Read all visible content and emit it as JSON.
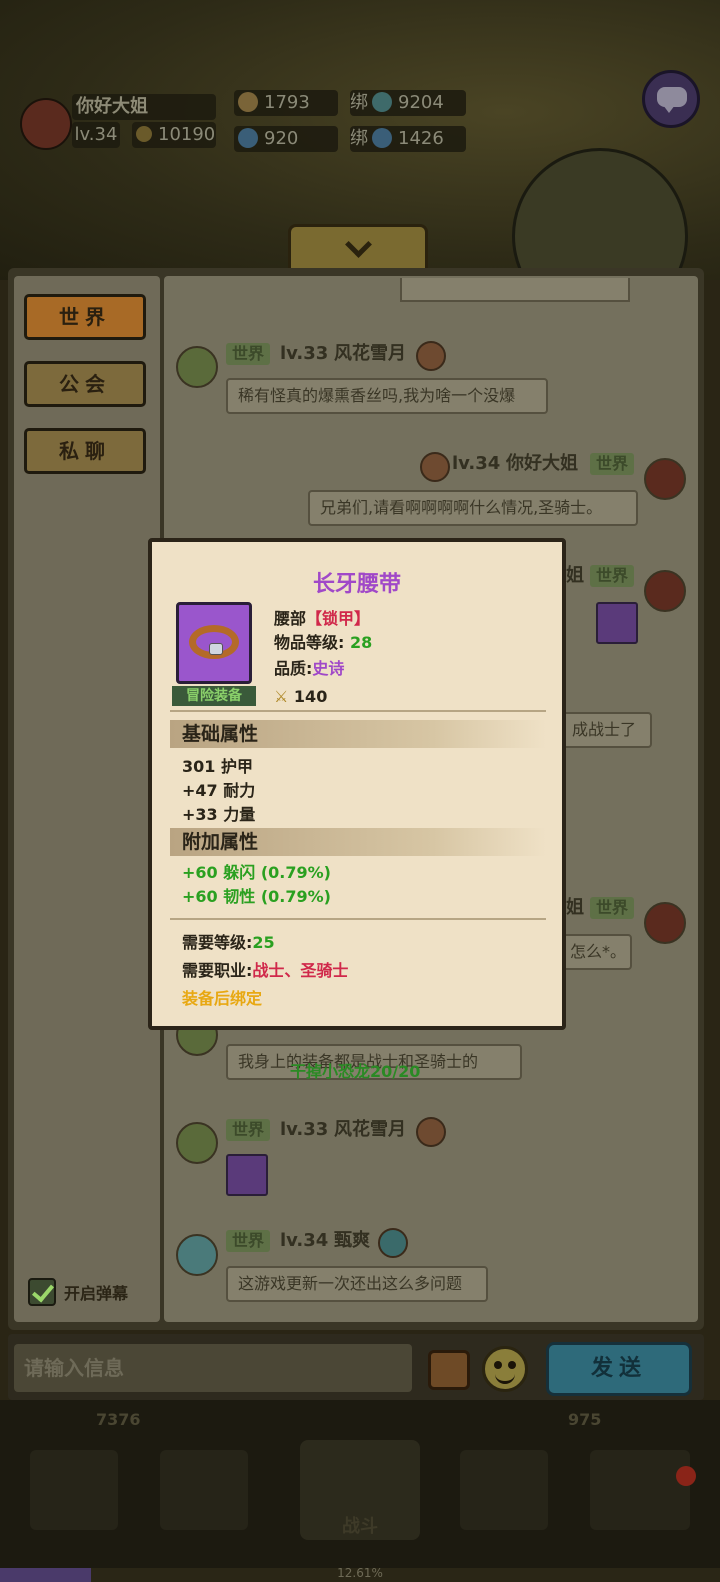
{
  "player": {
    "name": "你好大姐",
    "level": "lv.34",
    "power": "10190"
  },
  "currency": {
    "gold": "1793",
    "bound_gold_label": "绑",
    "bound_gold": "9204",
    "gems": "920",
    "bound_gems_label": "绑",
    "bound_gems": "1426"
  },
  "sidebar": {
    "tabs": [
      {
        "label": "世界"
      },
      {
        "label": "公会"
      },
      {
        "label": "私聊"
      }
    ],
    "barrage_label": "开启弹幕"
  },
  "messages": [
    {
      "channel": "世界",
      "level": "lv.33",
      "user": "风花雪月",
      "text": "稀有怪真的爆熏香丝吗,我为啥一个没爆"
    },
    {
      "channel": "世界",
      "level": "lv.34",
      "user": "你好大姐",
      "text": "兄弟们,请看啊啊啊啊什么情况,圣骑士。"
    },
    {
      "channel": "世界",
      "fragment": "姐",
      "text": "成战士了"
    },
    {
      "channel": "世界",
      "fragment": "姐",
      "text": "怎么*。"
    },
    {
      "text": "我身上的装备都是战士和圣骑士的"
    },
    {
      "channel": "世界",
      "level": "lv.33",
      "user": "风花雪月"
    },
    {
      "channel": "世界",
      "level": "lv.34",
      "user": "甄爽",
      "text": "这游戏更新一次还出这么多问题"
    }
  ],
  "floating_notice": "干掉小恐龙20/20",
  "input": {
    "placeholder": "请输入信息",
    "send_label": "发送"
  },
  "bottom": {
    "stat_left": "7376",
    "stat_right": "975",
    "battle_label": "战斗",
    "progress": "12.61%"
  },
  "tooltip": {
    "title": "长牙腰带",
    "slot": "腰部",
    "armor_type": "【锁甲】",
    "item_level_label": "物品等级:",
    "item_level": "28",
    "quality_label": "品质:",
    "quality": "史诗",
    "score": "140",
    "category": "冒险装备",
    "base_header": "基础属性",
    "base_stats": [
      "301 护甲",
      "+47 耐力",
      "+33 力量"
    ],
    "extra_header": "附加属性",
    "extra_stats": [
      "+60 躲闪 (0.79%)",
      "+60 韧性 (0.79%)"
    ],
    "req_level_label": "需要等级:",
    "req_level": "25",
    "req_class_label": "需要职业:",
    "req_class": "战士、圣骑士",
    "bind": "装备后绑定"
  },
  "colors": {
    "epic": "#a048c8",
    "stat_green": "#2aa020",
    "class_red": "#d0284a",
    "bind_yellow": "#e8a812"
  }
}
